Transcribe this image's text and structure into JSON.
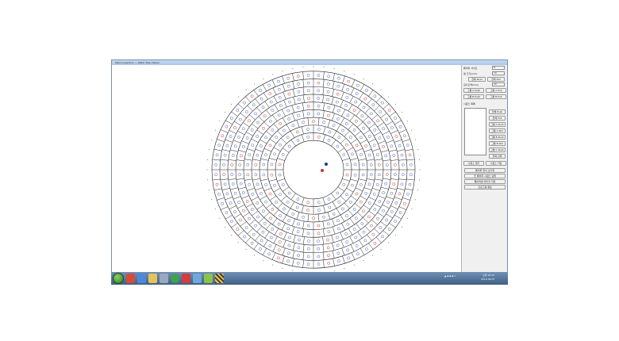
{
  "window": {
    "title": "Mark Inspection — Wafer Map Viewer"
  },
  "panel": {
    "field1_label": "웨이퍼 사이즈",
    "field1_value": "8",
    "field2_label": "셀 크기(mm)",
    "field2_value": "10",
    "row1_a": "전체 Push",
    "row1_b": "전체 Pull",
    "field3_label": "검사간격(mm)",
    "field3_value": "20",
    "row2_a": "그룹 A Push",
    "row2_b": "그룹 A Pull",
    "row3_a": "그룹 B Push",
    "row3_b": "그룹 B Pull",
    "section_label": "시퀀스 목록",
    "side_buttons": [
      "전체 Push",
      "전체 Pull",
      "그룹 A Push",
      "그룹 A Pull",
      "그룹 B Push",
      "그룹 B Pull",
      "그룹 C Push",
      "전체 선택"
    ],
    "seq_open": "시퀀스 열기",
    "seq_save": "시퀀스 저장",
    "wide_buttons": [
      "웨이퍼 위치 초기화",
      "전 웨이퍼 시퀀스 실행",
      "웨이퍼맵 이미지 저장"
    ],
    "exit_label": "프로그램 종료"
  },
  "taskbar": {
    "time": "오후 10:22",
    "date": "2014-09-07"
  },
  "colors": {
    "grid_line": "#222222",
    "ring_dark": "#1f3a8a",
    "ring_red": "#c03a3a",
    "ring_blue": "#4a5fb5"
  }
}
